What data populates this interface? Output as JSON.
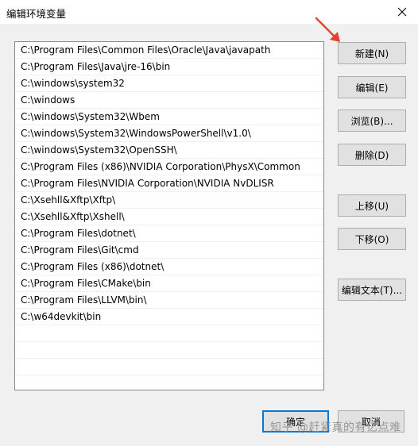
{
  "dialog": {
    "title": "编辑环境变量"
  },
  "paths": [
    "C:\\Program Files\\Common Files\\Oracle\\Java\\javapath",
    "C:\\Program Files\\Java\\jre-16\\bin",
    "C:\\windows\\system32",
    "C:\\windows",
    "C:\\windows\\System32\\Wbem",
    "C:\\windows\\System32\\WindowsPowerShell\\v1.0\\",
    "C:\\windows\\System32\\OpenSSH\\",
    "C:\\Program Files (x86)\\NVIDIA Corporation\\PhysX\\Common",
    "C:\\Program Files\\NVIDIA Corporation\\NVIDIA NvDLISR",
    "C:\\Xsehll&Xftp\\Xftp\\",
    "C:\\Xsehll&Xftp\\Xshell\\",
    "C:\\Program Files\\dotnet\\",
    "C:\\Program Files\\Git\\cmd",
    "C:\\Program Files (x86)\\dotnet\\",
    "C:\\Program Files\\CMake\\bin",
    "C:\\Program Files\\LLVM\\bin\\",
    "C:\\w64devkit\\bin"
  ],
  "buttons": {
    "new": "新建(N)",
    "edit": "编辑(E)",
    "browse": "浏览(B)...",
    "delete": "删除(D)",
    "move_up": "上移(U)",
    "move_down": "下移(O)",
    "edit_text": "编辑文本(T)...",
    "ok": "确定",
    "cancel": "取消"
  },
  "watermark": "知乎 @赶紧真的有亿点难",
  "colors": {
    "annotation_arrow": "#e8422f",
    "focus_border": "#0078d7"
  }
}
